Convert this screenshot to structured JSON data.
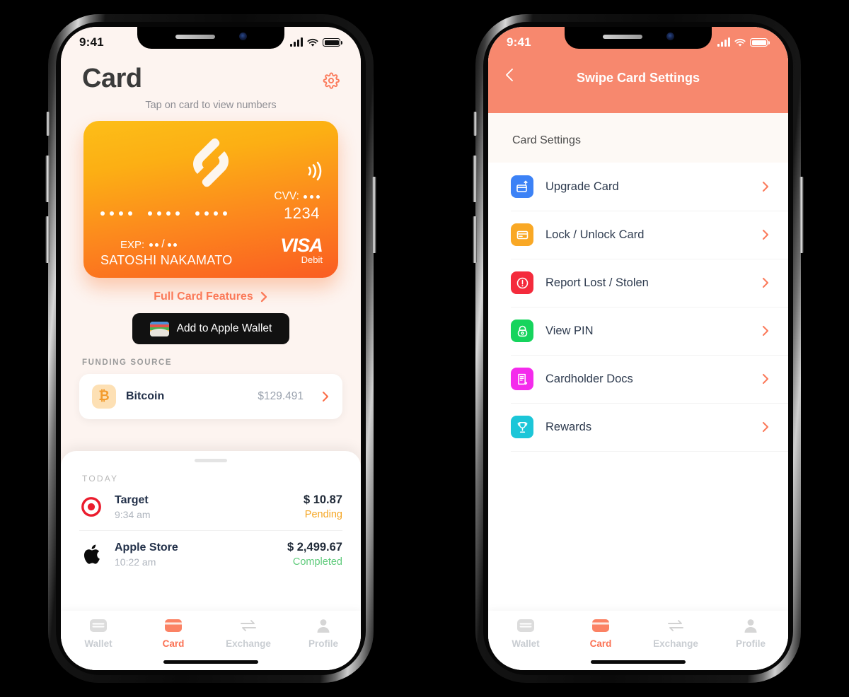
{
  "theme": {
    "accent": "#FB7254",
    "nav_bg": "#F7886E",
    "screen_bg": "#FDF4F0",
    "card_gradient_from": "#FDBE18",
    "card_gradient_to": "#FA5C22",
    "pending_color": "#F5A623",
    "completed_color": "#5FCB7B"
  },
  "left_phone": {
    "status_bar": {
      "time": "9:41",
      "signal_icon": "cellular-bars-icon",
      "wifi_icon": "wifi-icon",
      "battery_icon": "battery-full-icon"
    },
    "header": {
      "title": "Card",
      "settings_icon": "gear-icon",
      "subtitle": "Tap on card to view numbers"
    },
    "card": {
      "brand_logo_icon": "swipe-logo-icon",
      "contactless_icon": "contactless-icon",
      "cvv_label": "CVV:",
      "cvv_masked": "•••",
      "last_four": "1234",
      "pan_masked_groups": [
        "••••",
        "••••",
        "••••"
      ],
      "exp_label": "EXP:",
      "exp_masked": "••/••",
      "cardholder": "SATOSHI NAKAMATO",
      "network": "VISA",
      "network_type": "Debit"
    },
    "full_card_features": {
      "label": "Full Card Features",
      "chevron_icon": "chevron-right-icon"
    },
    "apple_wallet_button": {
      "label": "Add to Apple Wallet",
      "icon": "apple-wallet-icon"
    },
    "funding_source": {
      "section_label": "FUNDING SOURCE",
      "icon": "bitcoin-icon",
      "symbol": "₿",
      "name": "Bitcoin",
      "amount": "$129.491",
      "chevron_icon": "chevron-right-icon"
    },
    "transactions": {
      "grab_handle": "sheet-grab-handle",
      "section_label": "TODAY",
      "items": [
        {
          "icon": "target-logo-icon",
          "merchant": "Target",
          "time": "9:34 am",
          "amount": "$ 10.87",
          "status": "Pending",
          "status_color": "#F5A623"
        },
        {
          "icon": "apple-logo-icon",
          "merchant": "Apple Store",
          "time": "10:22 am",
          "amount": "$ 2,499.67",
          "status": "Completed",
          "status_color": "#5FCB7B"
        }
      ]
    },
    "tabbar": {
      "items": [
        {
          "label": "Wallet",
          "icon": "wallet-icon",
          "active": false
        },
        {
          "label": "Card",
          "icon": "card-icon",
          "active": true
        },
        {
          "label": "Exchange",
          "icon": "exchange-icon",
          "active": false
        },
        {
          "label": "Profile",
          "icon": "profile-icon",
          "active": false
        }
      ]
    }
  },
  "right_phone": {
    "status_bar": {
      "time": "9:41",
      "signal_icon": "cellular-bars-icon",
      "wifi_icon": "wifi-icon",
      "battery_icon": "battery-full-icon"
    },
    "nav": {
      "back_icon": "chevron-left-icon",
      "title": "Swipe Card Settings"
    },
    "section_label": "Card Settings",
    "settings": [
      {
        "label": "Upgrade Card",
        "icon": "upgrade-card-icon",
        "icon_bg": "#3C82F6",
        "chevron_icon": "chevron-right-icon"
      },
      {
        "label": "Lock / Unlock Card",
        "icon": "credit-card-icon",
        "icon_bg": "#F9A825",
        "chevron_icon": "chevron-right-icon"
      },
      {
        "label": "Report Lost / Stolen",
        "icon": "alert-circle-icon",
        "icon_bg": "#F42B3C",
        "chevron_icon": "chevron-right-icon"
      },
      {
        "label": "View PIN",
        "icon": "lock-icon",
        "icon_bg": "#16D45D",
        "chevron_icon": "chevron-right-icon"
      },
      {
        "label": "Cardholder Docs",
        "icon": "document-icon",
        "icon_bg": "#F42BEC",
        "chevron_icon": "chevron-right-icon"
      },
      {
        "label": "Rewards",
        "icon": "trophy-icon",
        "icon_bg": "#1CC6D8",
        "chevron_icon": "chevron-right-icon"
      }
    ],
    "tabbar": {
      "items": [
        {
          "label": "Wallet",
          "icon": "wallet-icon",
          "active": false
        },
        {
          "label": "Card",
          "icon": "card-icon",
          "active": true
        },
        {
          "label": "Exchange",
          "icon": "exchange-icon",
          "active": false
        },
        {
          "label": "Profile",
          "icon": "profile-icon",
          "active": false
        }
      ]
    }
  }
}
